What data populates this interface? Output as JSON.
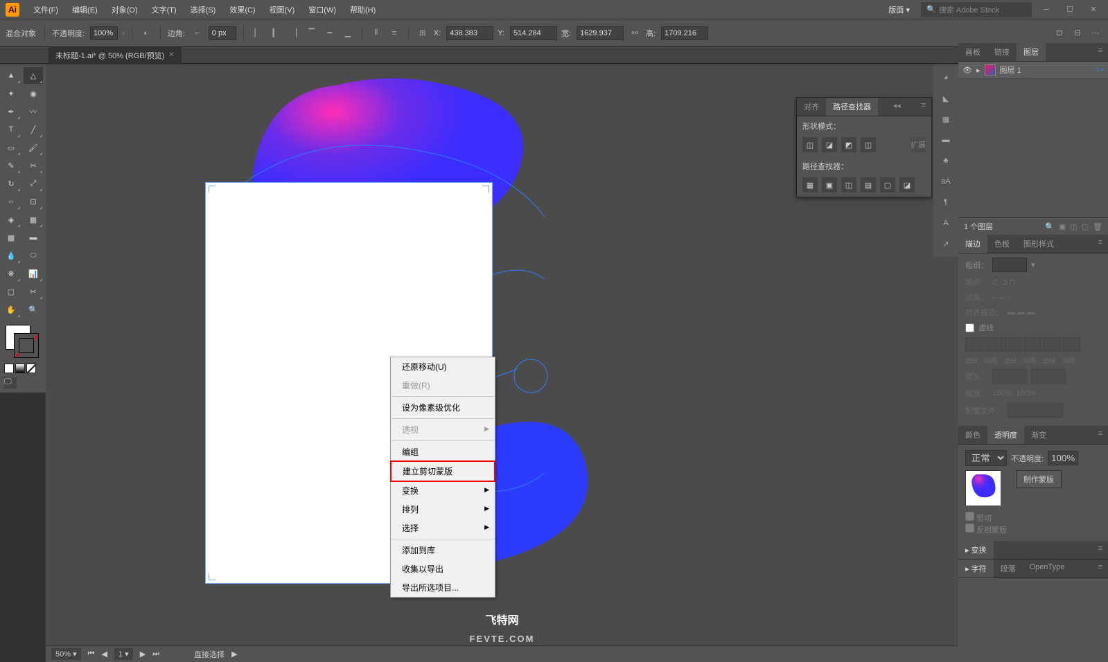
{
  "app": {
    "logo": "Ai"
  },
  "menu": [
    "文件(F)",
    "编辑(E)",
    "对象(O)",
    "文字(T)",
    "选择(S)",
    "效果(C)",
    "视图(V)",
    "窗口(W)",
    "帮助(H)"
  ],
  "topRight": {
    "layout": "版面",
    "searchPlaceholder": "搜索 Adobe Stock"
  },
  "control": {
    "blend": "混合对象",
    "opacityLabel": "不透明度:",
    "opacity": "100%",
    "cornerLabel": "边角:",
    "corner": "0 px",
    "xLabel": "X:",
    "x": "438.383",
    "yLabel": "Y:",
    "y": "514.284",
    "wLabel": "宽:",
    "w": "1629.937",
    "hLabel": "高:",
    "h": "1709.216"
  },
  "document": {
    "tab": "未标题-1.ai* @ 50% (RGB/预览)"
  },
  "contextMenu": {
    "items": [
      {
        "label": "还原移动(U)",
        "dis": false
      },
      {
        "label": "重做(R)",
        "dis": true
      },
      {
        "sep": true
      },
      {
        "label": "设为像素级优化",
        "dis": false
      },
      {
        "sep": true
      },
      {
        "label": "透视",
        "dis": true,
        "sub": true
      },
      {
        "sep": true
      },
      {
        "label": "编组",
        "dis": false
      },
      {
        "label": "建立剪切蒙版",
        "dis": false,
        "highlight": true
      },
      {
        "label": "变换",
        "dis": false,
        "sub": true
      },
      {
        "label": "排列",
        "dis": false,
        "sub": true
      },
      {
        "label": "选择",
        "dis": false,
        "sub": true
      },
      {
        "sep": true
      },
      {
        "label": "添加到库",
        "dis": false
      },
      {
        "label": "收集以导出",
        "dis": false
      },
      {
        "label": "导出所选项目...",
        "dis": false
      }
    ]
  },
  "alignPanel": {
    "tabs": [
      "对齐",
      "路径查找器"
    ],
    "section1": "形状模式：",
    "section2": "路径查找器："
  },
  "layersPanel": {
    "tabs": [
      "画板",
      "链接",
      "图层"
    ],
    "active": 2,
    "layer": "图层 1",
    "footer": "1 个图层"
  },
  "strokePanel": {
    "tabs": [
      "描边",
      "色板",
      "图形样式"
    ],
    "active": 0,
    "weightLabel": "粗细：",
    "dashLabel": "虚线"
  },
  "colorPanel": {
    "tabs": [
      "颜色",
      "透明度",
      "渐变"
    ],
    "active": 1,
    "mode": "正常",
    "opacityLabel": "不透明度:",
    "opacity": "100%",
    "makeMask": "制作蒙版",
    "clip": "剪切",
    "invert": "反相蒙版"
  },
  "transformPanel": {
    "title": "变换"
  },
  "charPanel": {
    "tabs": [
      "字符",
      "段落",
      "OpenType"
    ]
  },
  "status": {
    "zoom": "50%",
    "artboard": "1",
    "tool": "直接选择"
  },
  "watermark": {
    "cn": "飞特网",
    "en": "FEVTE.COM"
  }
}
